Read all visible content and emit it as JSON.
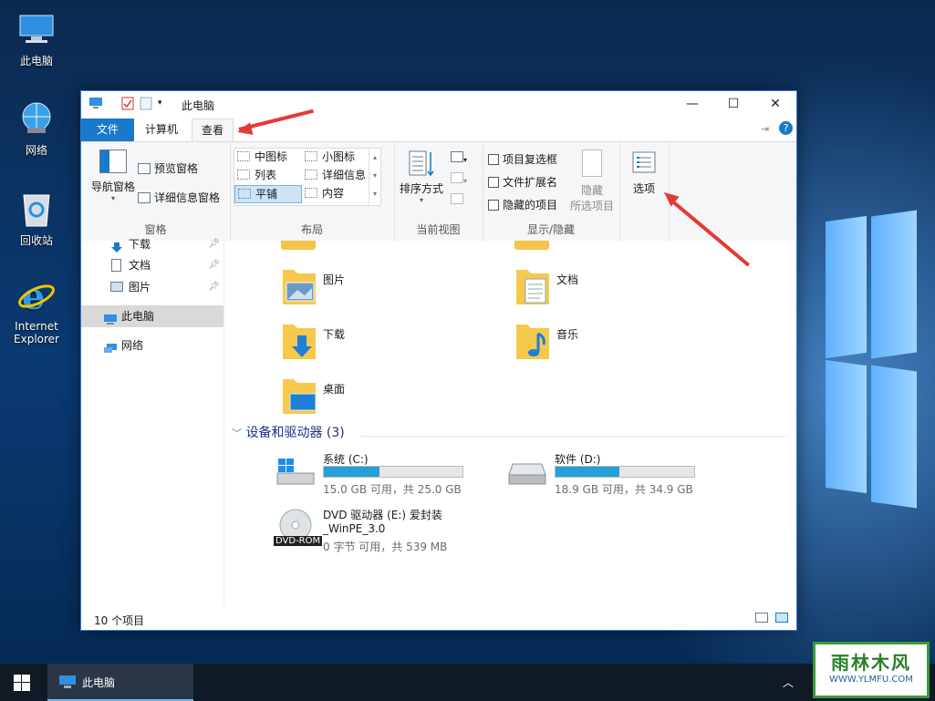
{
  "desktop": {
    "icons": [
      {
        "label": "此电脑",
        "icon": "computer-icon"
      },
      {
        "label": "网络",
        "icon": "network-globe-icon"
      },
      {
        "label": "回收站",
        "icon": "recycle-bin-icon"
      },
      {
        "label": "Internet Explorer",
        "icon": "internet-explorer-icon"
      }
    ]
  },
  "window": {
    "title": "此电脑",
    "controls": {
      "minimize": "—",
      "maximize": "☐",
      "close": "✕"
    },
    "help": "?"
  },
  "ribbon": {
    "tabs": [
      {
        "label": "文件"
      },
      {
        "label": "计算机"
      },
      {
        "label": "查看",
        "active": true
      }
    ],
    "groups": {
      "pane": {
        "label": "窗格",
        "nav_pane": "导航窗格",
        "preview_pane": "预览窗格",
        "details_pane": "详细信息窗格"
      },
      "layout": {
        "label": "布局",
        "items": [
          "中图标",
          "小图标",
          "列表",
          "详细信息",
          "平铺",
          "内容"
        ],
        "selected": "平铺"
      },
      "current_view": {
        "label": "当前视图",
        "sort_by": "排序方式"
      },
      "show_hide": {
        "label": "显示/隐藏",
        "item_checkboxes": "项目复选框",
        "file_extensions": "文件扩展名",
        "hidden_items": "隐藏的项目",
        "hide_selected_line1": "隐藏",
        "hide_selected_line2": "所选项目"
      },
      "options": {
        "label": "选项"
      }
    }
  },
  "nav_pane": {
    "items": [
      {
        "label": "下载",
        "pinned": true
      },
      {
        "label": "文档",
        "pinned": true
      },
      {
        "label": "图片",
        "pinned": true
      },
      {
        "label": "此电脑",
        "selected": true
      },
      {
        "label": "网络"
      }
    ]
  },
  "content": {
    "folders": [
      {
        "label": "图片"
      },
      {
        "label": "文档"
      },
      {
        "label": "下载"
      },
      {
        "label": "音乐"
      },
      {
        "label": "桌面"
      }
    ],
    "devices_header": "设备和驱动器 (3)",
    "drives": [
      {
        "name": "系统 (C:)",
        "size": "15.0 GB 可用，共 25.0 GB",
        "used_fraction": 0.4
      },
      {
        "name": "软件 (D:)",
        "size": "18.9 GB 可用，共 34.9 GB",
        "used_fraction": 0.46
      },
      {
        "name_line1": "DVD 驱动器 (E:) 爱封装",
        "name_line2": "_WinPE_3.0",
        "size": "0 字节 可用，共 539 MB",
        "badge": "DVD-ROM"
      }
    ]
  },
  "status_bar": {
    "item_count": "10 个项目"
  },
  "taskbar": {
    "app_label": "此电脑"
  },
  "watermark": {
    "brand": "雨林木风",
    "url": "WWW.YLMFU.COM"
  },
  "colors": {
    "accent": "#1979ca",
    "drive_bar": "#26a0da",
    "annotation_arrow": "#e53935"
  }
}
